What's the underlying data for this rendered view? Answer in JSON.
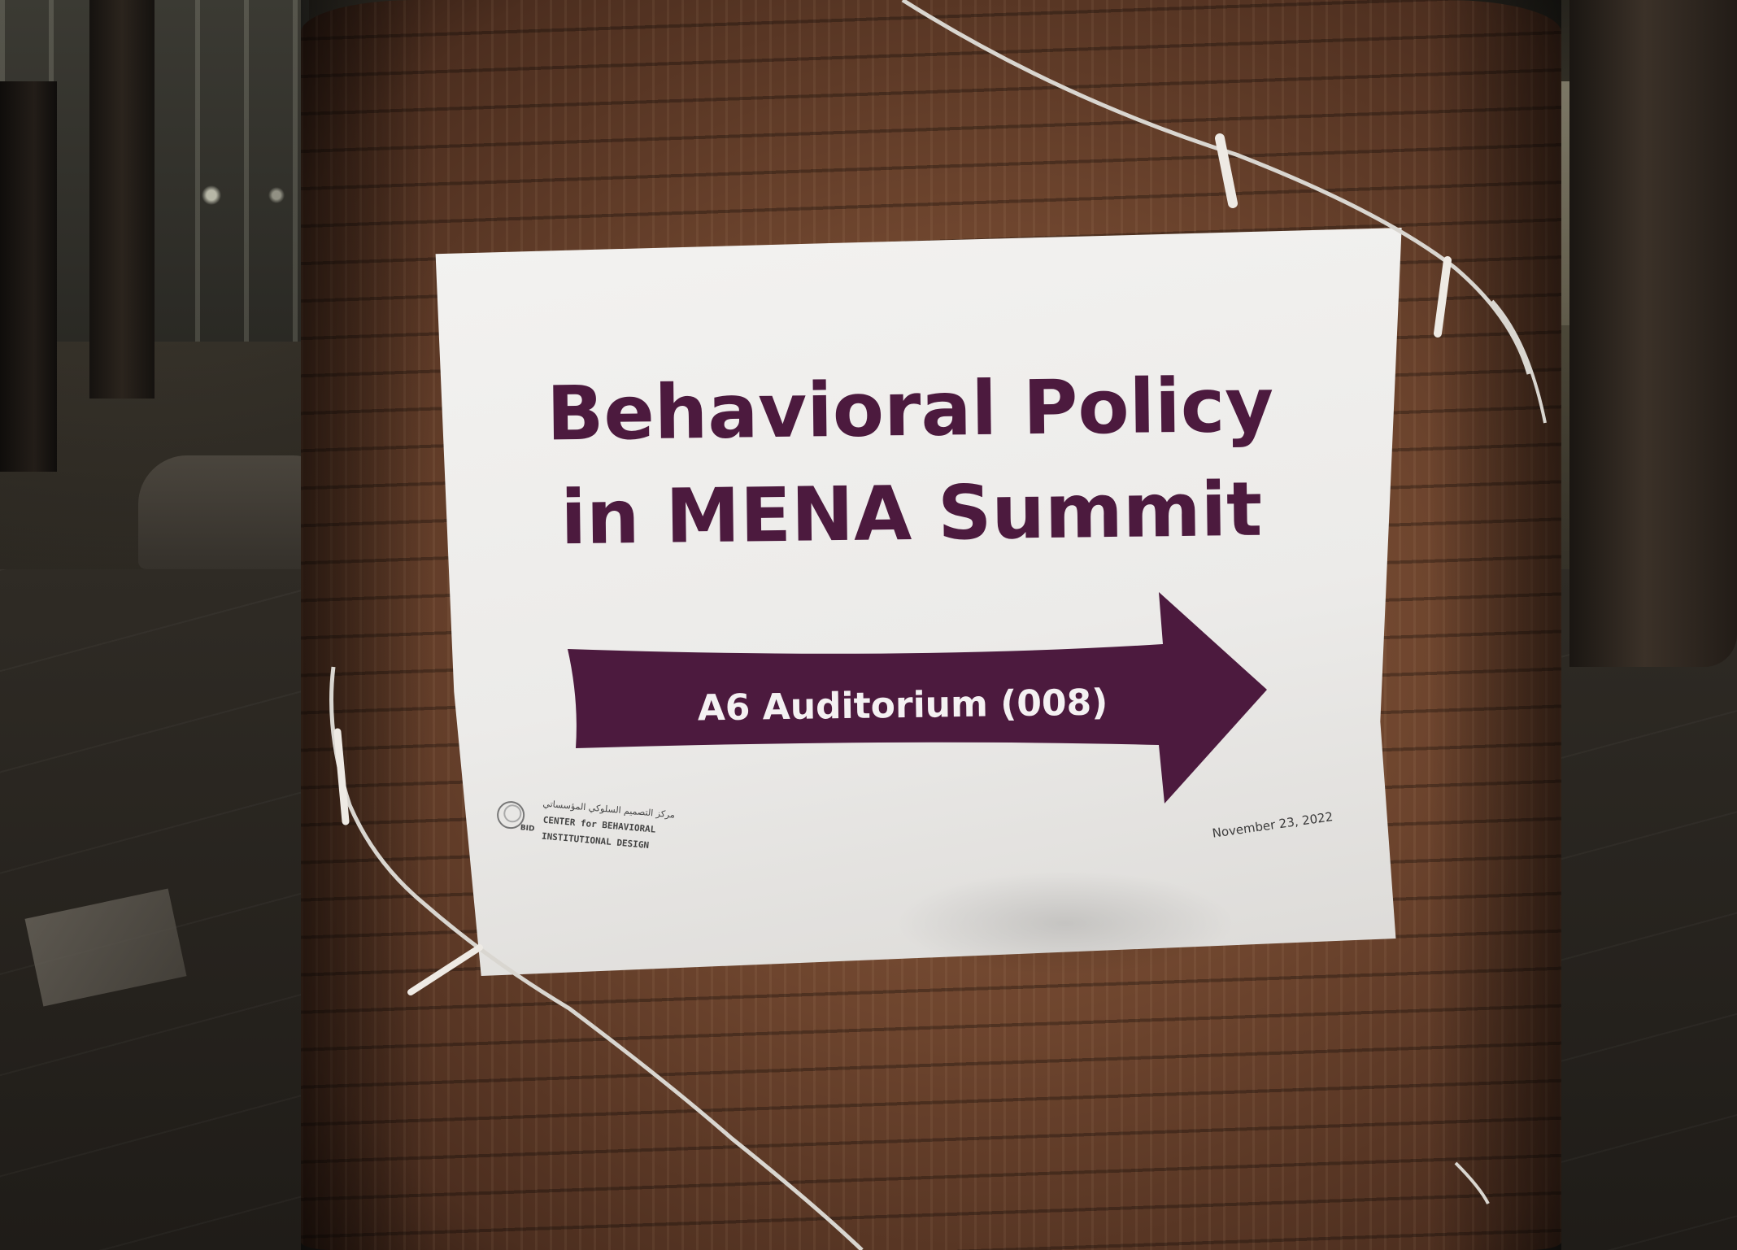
{
  "sign": {
    "title_line1": "Behavioral Policy",
    "title_line2": "in MENA Summit",
    "direction_label": "A6 Auditorium (008)",
    "date": "November 23, 2022",
    "title_color": "#4c1a3e",
    "arrow_color": "#4c1a3e",
    "arrow_direction": "right"
  },
  "logo": {
    "arabic_text": "مركز التصميم السلوكي المؤسساتي",
    "abbreviation": "BID",
    "line1": "CENTER for BEHAVIORAL",
    "line2": "INSTITUTIONAL DESIGN"
  }
}
